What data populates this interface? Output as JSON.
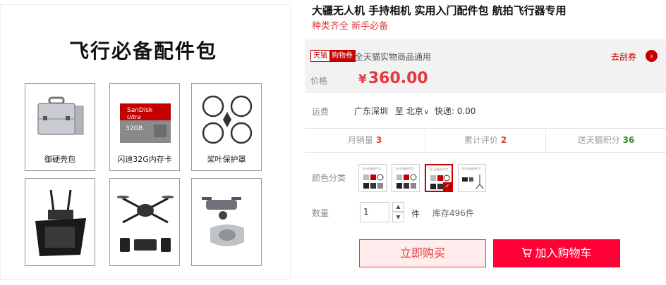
{
  "left": {
    "headline": "飞行必备配件包",
    "items": [
      {
        "caption": "御硬壳包"
      },
      {
        "caption": "闪迪32G内存卡",
        "card_brand": "SanDisk",
        "card_line": "Ultra",
        "card_size": "32GB"
      },
      {
        "caption": "桨叶保护罩"
      },
      {
        "caption": ""
      },
      {
        "caption": ""
      },
      {
        "caption": ""
      }
    ]
  },
  "product": {
    "title": "大疆无人机 手持相机 实用入门配件包 航拍飞行器专用",
    "subtitle": "种类齐全 新手必备"
  },
  "promo": {
    "badge_left": "天猫",
    "badge_right": "购物券",
    "text": "全天猫实物商品通用",
    "coupon_link": "去刮券",
    "coupon_arrow": "›"
  },
  "price": {
    "label": "价格",
    "currency": "¥",
    "value": "360.00"
  },
  "shipping": {
    "label": "运费",
    "origin": "广东深圳",
    "to": "至",
    "destination": "北京",
    "chevron": "∨",
    "express": "快递: 0.00"
  },
  "stats": [
    {
      "label": "月销量",
      "value": "3"
    },
    {
      "label": "累计评价",
      "value": "2"
    },
    {
      "label": "送天猫积分",
      "value": "36"
    }
  ],
  "options": {
    "label": "颜色分类",
    "thumb_text": "飞行必备配件包",
    "selected_index": 2,
    "check": "✓"
  },
  "quantity": {
    "label": "数量",
    "value": "1",
    "unit": "件",
    "stock": "库存496件",
    "up": "▲",
    "down": "▼"
  },
  "buttons": {
    "buy": "立即购买",
    "cart": "加入购物车",
    "cart_icon": "cart-icon"
  },
  "colors": {
    "accent": "#e4393c",
    "tmall_red": "#c40000",
    "cart_red": "#ff0036",
    "points_green": "#2a8a2a"
  }
}
